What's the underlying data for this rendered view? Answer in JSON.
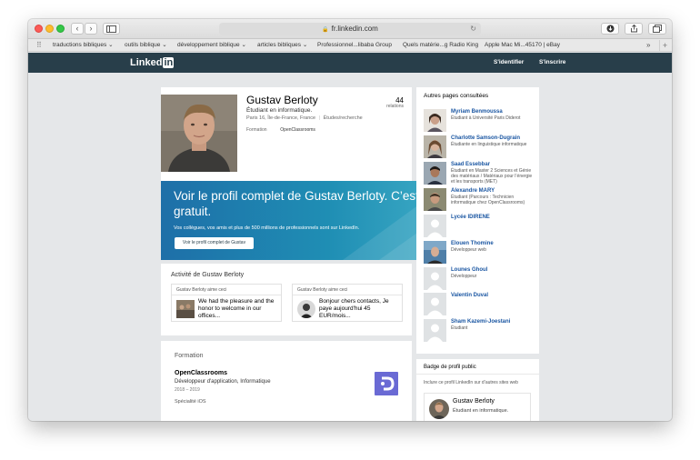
{
  "browser": {
    "url": "fr.linkedin.com",
    "bookmarks": [
      "traductions bibliques ⌄",
      "outils biblique ⌄",
      "développement biblique ⌄",
      "articles bibliques ⌄",
      "Professionnel...libaba Group",
      "Quels matérie...g Radio King",
      "Apple Mac Mi...45170 | eBay"
    ]
  },
  "header": {
    "logo_text": "Linked",
    "logo_in": "in",
    "signin": "S'identifier",
    "signup": "S'inscrire"
  },
  "profile": {
    "name": "Gustav Berloty",
    "headline": "Étudiant en informatique.",
    "location": "Paris 16, Île-de-France, France",
    "industry": "Études/recherche",
    "formation_label": "Formation",
    "formation_value": "OpenClassrooms",
    "connections": "44",
    "connections_label": "relations"
  },
  "banner": {
    "title": "Voir le profil complet de Gustav Berloty. C’est gratuit.",
    "subtitle": "Vos collègues, vos amis et plus de 500 millions de professionnels sont sur LinkedIn.",
    "button": "Voir le profil complet de Gustav"
  },
  "activity": {
    "title": "Activité de Gustav Berloty",
    "items": [
      {
        "head": "Gustav Berloty aime ceci",
        "text": "We had the pleasure and the honor to welcome in our offices..."
      },
      {
        "head": "Gustav Berloty aime ceci",
        "text": "Bonjour chers contacts, Je paye aujourd'hui 45 EUR/mois..."
      }
    ]
  },
  "education": {
    "section_title": "Formation",
    "school": "OpenClassrooms",
    "degree": "Développeur d'application, Informatique",
    "years": "2018 – 2019",
    "specialty": "Spécialité iOS"
  },
  "sidebar": {
    "title": "Autres pages consultées",
    "people": [
      {
        "name": "Myriam Benmoussa",
        "desc": "Étudiant à Université Paris Diderot"
      },
      {
        "name": "Charlotte Samson-Dugrain",
        "desc": "Étudiante en linguistique informatique"
      },
      {
        "name": "Saad Essebbar",
        "desc": "Étudiant en Master 2 Sciences et Génie des matériaux / Matériaux pour l’énergie et les transports (MET)"
      },
      {
        "name": "Alexandre MARY",
        "desc": "Étudiant (Parcours : Technicien informatique chez OpenClassrooms)"
      },
      {
        "name": "Lycée IDIRENE",
        "desc": ""
      },
      {
        "name": "Elouen Thomine",
        "desc": "Développeur web"
      },
      {
        "name": "Lounes Ghoul",
        "desc": "Développeur"
      },
      {
        "name": "Valentin Duval",
        "desc": ""
      },
      {
        "name": "Sham Kazemi-Joestani",
        "desc": "Étudiant"
      }
    ],
    "badge_title": "Badge de profil public",
    "badge_sub": "Inclure ce profil LinkedIn sur d’autres sites web",
    "badge_name": "Gustav Berloty",
    "badge_headline": "Étudiant en informatique."
  }
}
